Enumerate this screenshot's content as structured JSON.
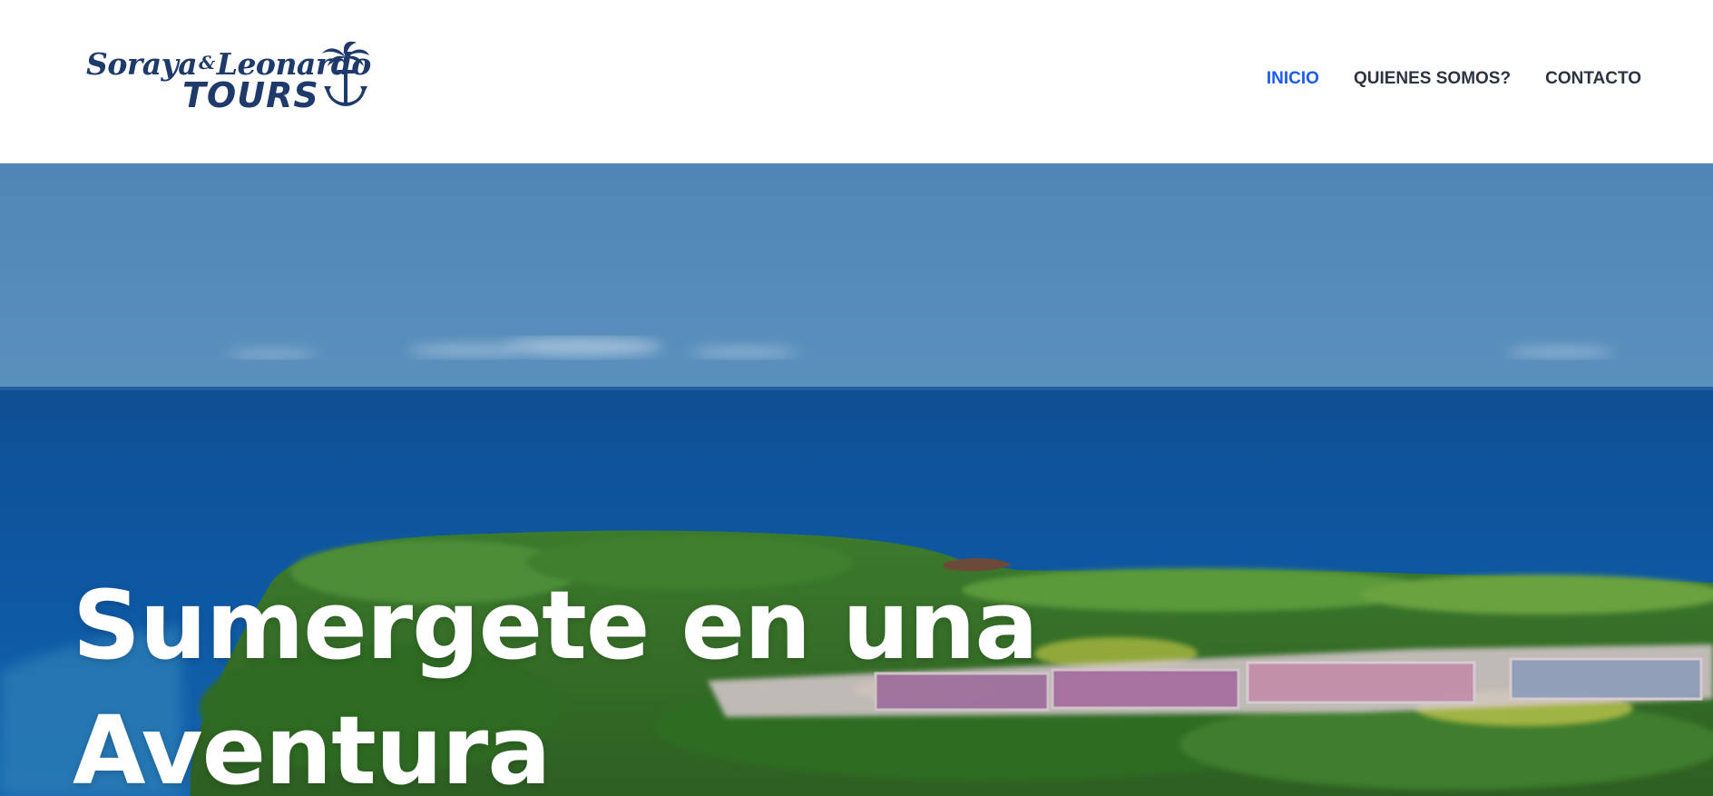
{
  "logo": {
    "line1": "Soraya",
    "ampersand": "&",
    "line1b": "Leonardo",
    "line2": "TOURS"
  },
  "nav": {
    "items": [
      {
        "label": "INICIO",
        "active": true
      },
      {
        "label": "QUIENES SOMOS?",
        "active": false
      },
      {
        "label": "CONTACTO",
        "active": false
      }
    ]
  },
  "hero": {
    "title_line1": "Sumergete en una",
    "title_line2": "Aventura"
  },
  "colors": {
    "nav_active": "#1a5cf0",
    "nav_text": "#2b3440",
    "logo": "#1d3a6b",
    "sky": "#5588b4",
    "sea": "#0f56a0",
    "vegetation": "#3f7d2e"
  },
  "icons": {
    "logo_mark": "palm-anchor-icon"
  }
}
